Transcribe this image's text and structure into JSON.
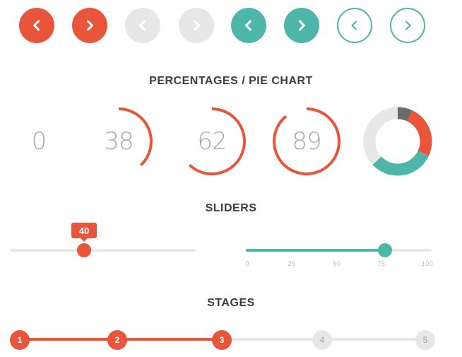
{
  "nav_buttons": [
    {
      "variant": "orange",
      "direction": "prev",
      "icon": "chevron-left-icon",
      "color": "#e8553a"
    },
    {
      "variant": "orange",
      "direction": "next",
      "icon": "chevron-right-icon",
      "color": "#e8553a"
    },
    {
      "variant": "grey",
      "direction": "prev",
      "icon": "chevron-left-icon",
      "color": "#e7e7e7"
    },
    {
      "variant": "grey",
      "direction": "next",
      "icon": "chevron-right-icon",
      "color": "#e7e7e7"
    },
    {
      "variant": "teal",
      "direction": "prev",
      "icon": "chevron-left-icon",
      "color": "#4db6a9"
    },
    {
      "variant": "teal",
      "direction": "next",
      "icon": "chevron-right-icon",
      "color": "#4db6a9"
    },
    {
      "variant": "outline",
      "direction": "prev",
      "icon": "chevron-left-icon",
      "color": "#4db6a9"
    },
    {
      "variant": "outline",
      "direction": "next",
      "icon": "chevron-right-icon",
      "color": "#4db6a9"
    }
  ],
  "percentages": {
    "title": "PERCENTAGES / PIE CHART",
    "rings": [
      {
        "label": "0",
        "value": 0
      },
      {
        "label": "38",
        "value": 38
      },
      {
        "label": "62",
        "value": 62
      },
      {
        "label": "89",
        "value": 89
      }
    ],
    "ring_color": "#e8553a",
    "pie": {
      "segments": [
        {
          "color": "#6b6b6b",
          "fraction": 0.07
        },
        {
          "color": "#e8553a",
          "fraction": 0.25
        },
        {
          "color": "#4db6a9",
          "fraction": 0.31
        },
        {
          "color": "#e7e7e7",
          "fraction": 0.37
        }
      ]
    }
  },
  "sliders": {
    "title": "SLIDERS",
    "slider1": {
      "value": 40,
      "tooltip": "40",
      "min": 0,
      "max": 100,
      "color": "#e8553a"
    },
    "slider2": {
      "value": 75,
      "min": 0,
      "max": 100,
      "color": "#4db6a9",
      "ticks": [
        "0",
        "25",
        "50",
        "75",
        "100"
      ]
    }
  },
  "stages": {
    "title": "STAGES",
    "items": [
      "1",
      "2",
      "3",
      "4",
      "5"
    ],
    "completed": 3,
    "active_color": "#e8553a",
    "inactive_color": "#e7e7e7"
  }
}
